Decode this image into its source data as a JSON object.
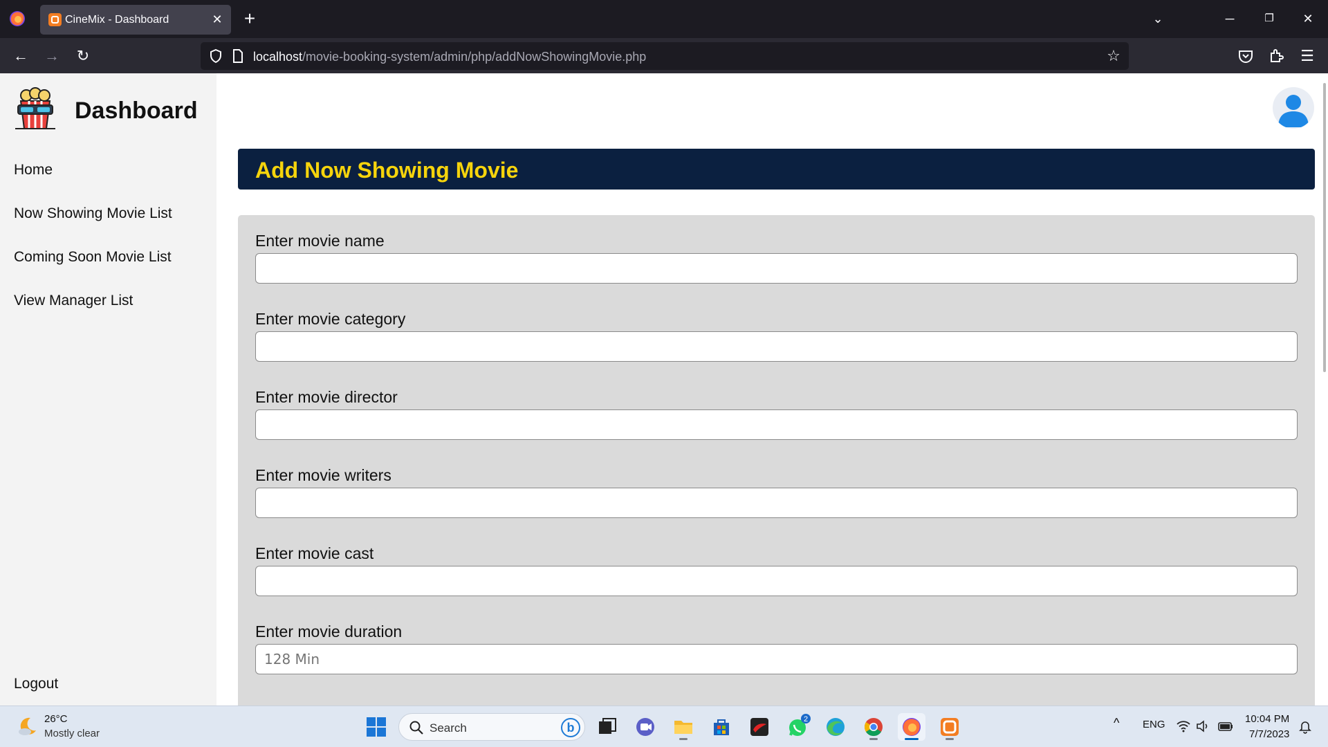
{
  "browser": {
    "tab_title": "CineMix - Dashboard",
    "url_host": "localhost",
    "url_path": "/movie-booking-system/admin/php/addNowShowingMovie.php"
  },
  "sidebar": {
    "title": "Dashboard",
    "items": [
      {
        "label": "Home"
      },
      {
        "label": "Now Showing Movie List"
      },
      {
        "label": "Coming Soon Movie List"
      },
      {
        "label": "View Manager List"
      }
    ],
    "logout_label": "Logout"
  },
  "main": {
    "header_title": "Add Now Showing Movie",
    "fields": [
      {
        "label": "Enter movie name",
        "placeholder": ""
      },
      {
        "label": "Enter movie category",
        "placeholder": ""
      },
      {
        "label": "Enter movie director",
        "placeholder": ""
      },
      {
        "label": "Enter movie writers",
        "placeholder": ""
      },
      {
        "label": "Enter movie cast",
        "placeholder": ""
      },
      {
        "label": "Enter movie duration",
        "placeholder": "128 Min"
      }
    ]
  },
  "taskbar": {
    "weather_temp": "26°C",
    "weather_desc": "Mostly clear",
    "search_label": "Search",
    "whatsapp_badge": "2",
    "language": "ENG",
    "time": "10:04 PM",
    "date": "7/7/2023"
  },
  "colors": {
    "header_bg": "#0b2040",
    "header_text": "#f6d40c",
    "form_panel_bg": "#dadada",
    "sidebar_bg": "#f3f3f3"
  }
}
